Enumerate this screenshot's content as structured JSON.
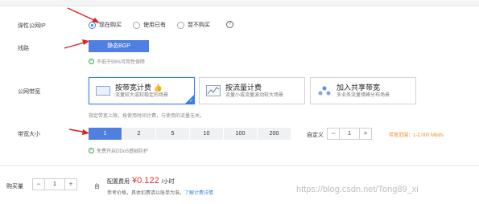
{
  "ip_row": {
    "label": "弹性公网IP",
    "options": [
      "现在购买",
      "使用已有",
      "暂不购买"
    ],
    "selected": 0,
    "help_glyph": "?"
  },
  "line_row": {
    "label": "线路",
    "button": "静态BGP",
    "hint": "不低于99%可用性保障"
  },
  "bw_type_row": {
    "label": "公网带宽",
    "cards": [
      {
        "title": "按带宽计费",
        "desc": "流量较大或较稳定的场景",
        "selected": true,
        "icon": "bandwidth-icon"
      },
      {
        "title": "按流量计费",
        "desc": "流量小或流量波动较大场景",
        "selected": false,
        "icon": "traffic-chart-icon"
      },
      {
        "title": "加入共享带宽",
        "desc": "多业务流量错峰分布场景",
        "selected": false,
        "icon": "shared-bandwidth-icon"
      }
    ],
    "note": "指定带宽上限，按使用时间计费，与使用的流量无关。"
  },
  "bw_size_row": {
    "label": "带宽大小",
    "options": [
      "1",
      "2",
      "5",
      "10",
      "100",
      "200"
    ],
    "selected": 0,
    "custom_label": "自定义",
    "custom_value": "1",
    "range": "带宽范围：1-2,000 Mbit/s",
    "hint": "免费开启DDoS基础防护"
  },
  "footer": {
    "qty_label": "购买量",
    "qty_value": "1",
    "unit": "台",
    "price_label": "配置费用",
    "price": "¥0.122",
    "price_unit": "/小时",
    "ref_text": "参考价格，具体扣费请以账单为准。",
    "ref_link": "了解计费详情"
  },
  "watermark": "https://blog.csdn.net/Tong89_xi"
}
